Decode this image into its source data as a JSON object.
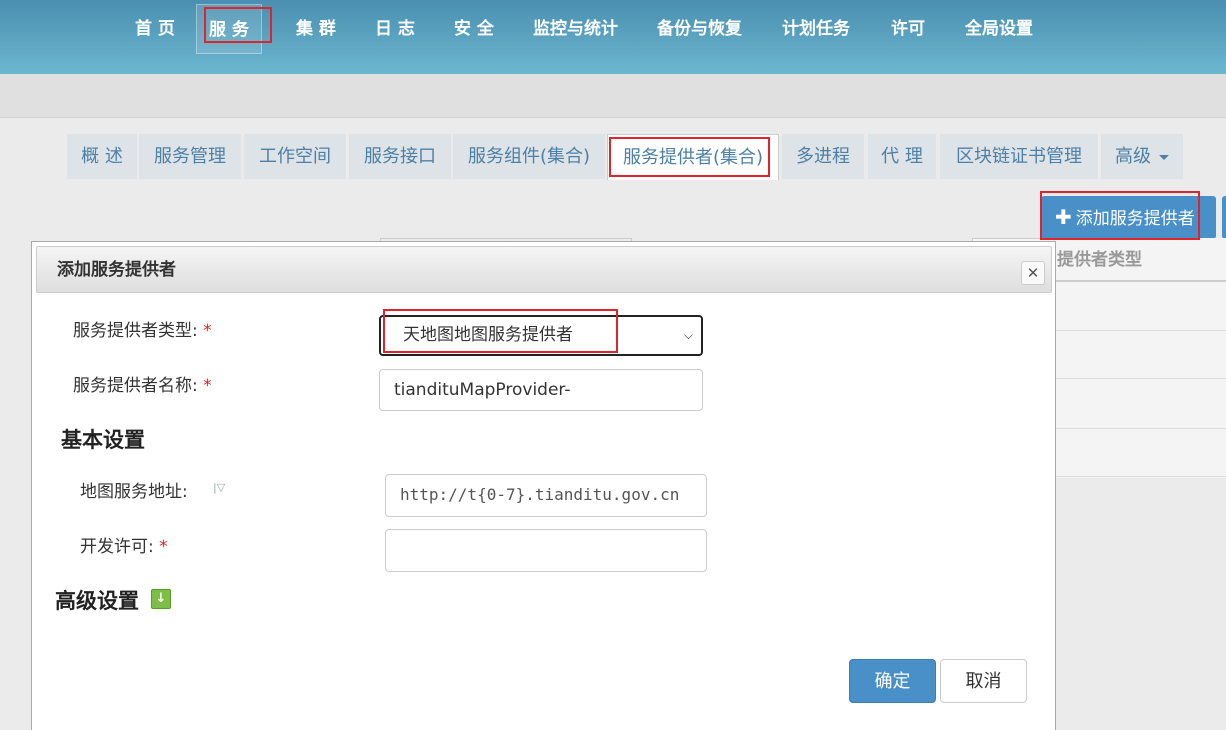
{
  "topnav": {
    "items": [
      "首 页",
      "服 务",
      "集 群",
      "日 志",
      "安 全",
      "监控与统计",
      "备份与恢复",
      "计划任务",
      "许可",
      "全局设置"
    ],
    "active_index": 1
  },
  "tabs": {
    "items": [
      "概 述",
      "服务管理",
      "工作空间",
      "服务接口",
      "服务组件(集合)",
      "服务提供者(集合)",
      "多进程",
      "代 理",
      "区块链证书管理",
      "高级"
    ],
    "active_index": 5
  },
  "toolbar": {
    "add_provider_label": "添加服务提供者"
  },
  "background_table": {
    "header_fragment": "提供者类型"
  },
  "modal": {
    "title": "添加服务提供者",
    "close_symbol": "✕",
    "fields": {
      "provider_type_label": "服务提供者类型:",
      "provider_type_value": "天地图地图服务提供者",
      "provider_name_label": "服务提供者名称:",
      "provider_name_value": "tiandituMapProvider-",
      "required_mark": "*"
    },
    "basic_settings": {
      "heading": "基本设置",
      "map_url_label": "地图服务地址:",
      "map_url_value": "http://t{0-7}.tianditu.gov.cn",
      "dev_key_label": "开发许可:",
      "dev_key_value": ""
    },
    "advanced_settings": {
      "heading": "高级设置",
      "expand_icon": "expand-down-icon"
    },
    "buttons": {
      "ok": "确定",
      "cancel": "取消"
    }
  },
  "colors": {
    "primary": "#4a90c8",
    "nav_gradient_top": "#4a8fb0",
    "tab_text": "#4d80a6",
    "required": "#d22222",
    "highlight": "#e0242c"
  }
}
